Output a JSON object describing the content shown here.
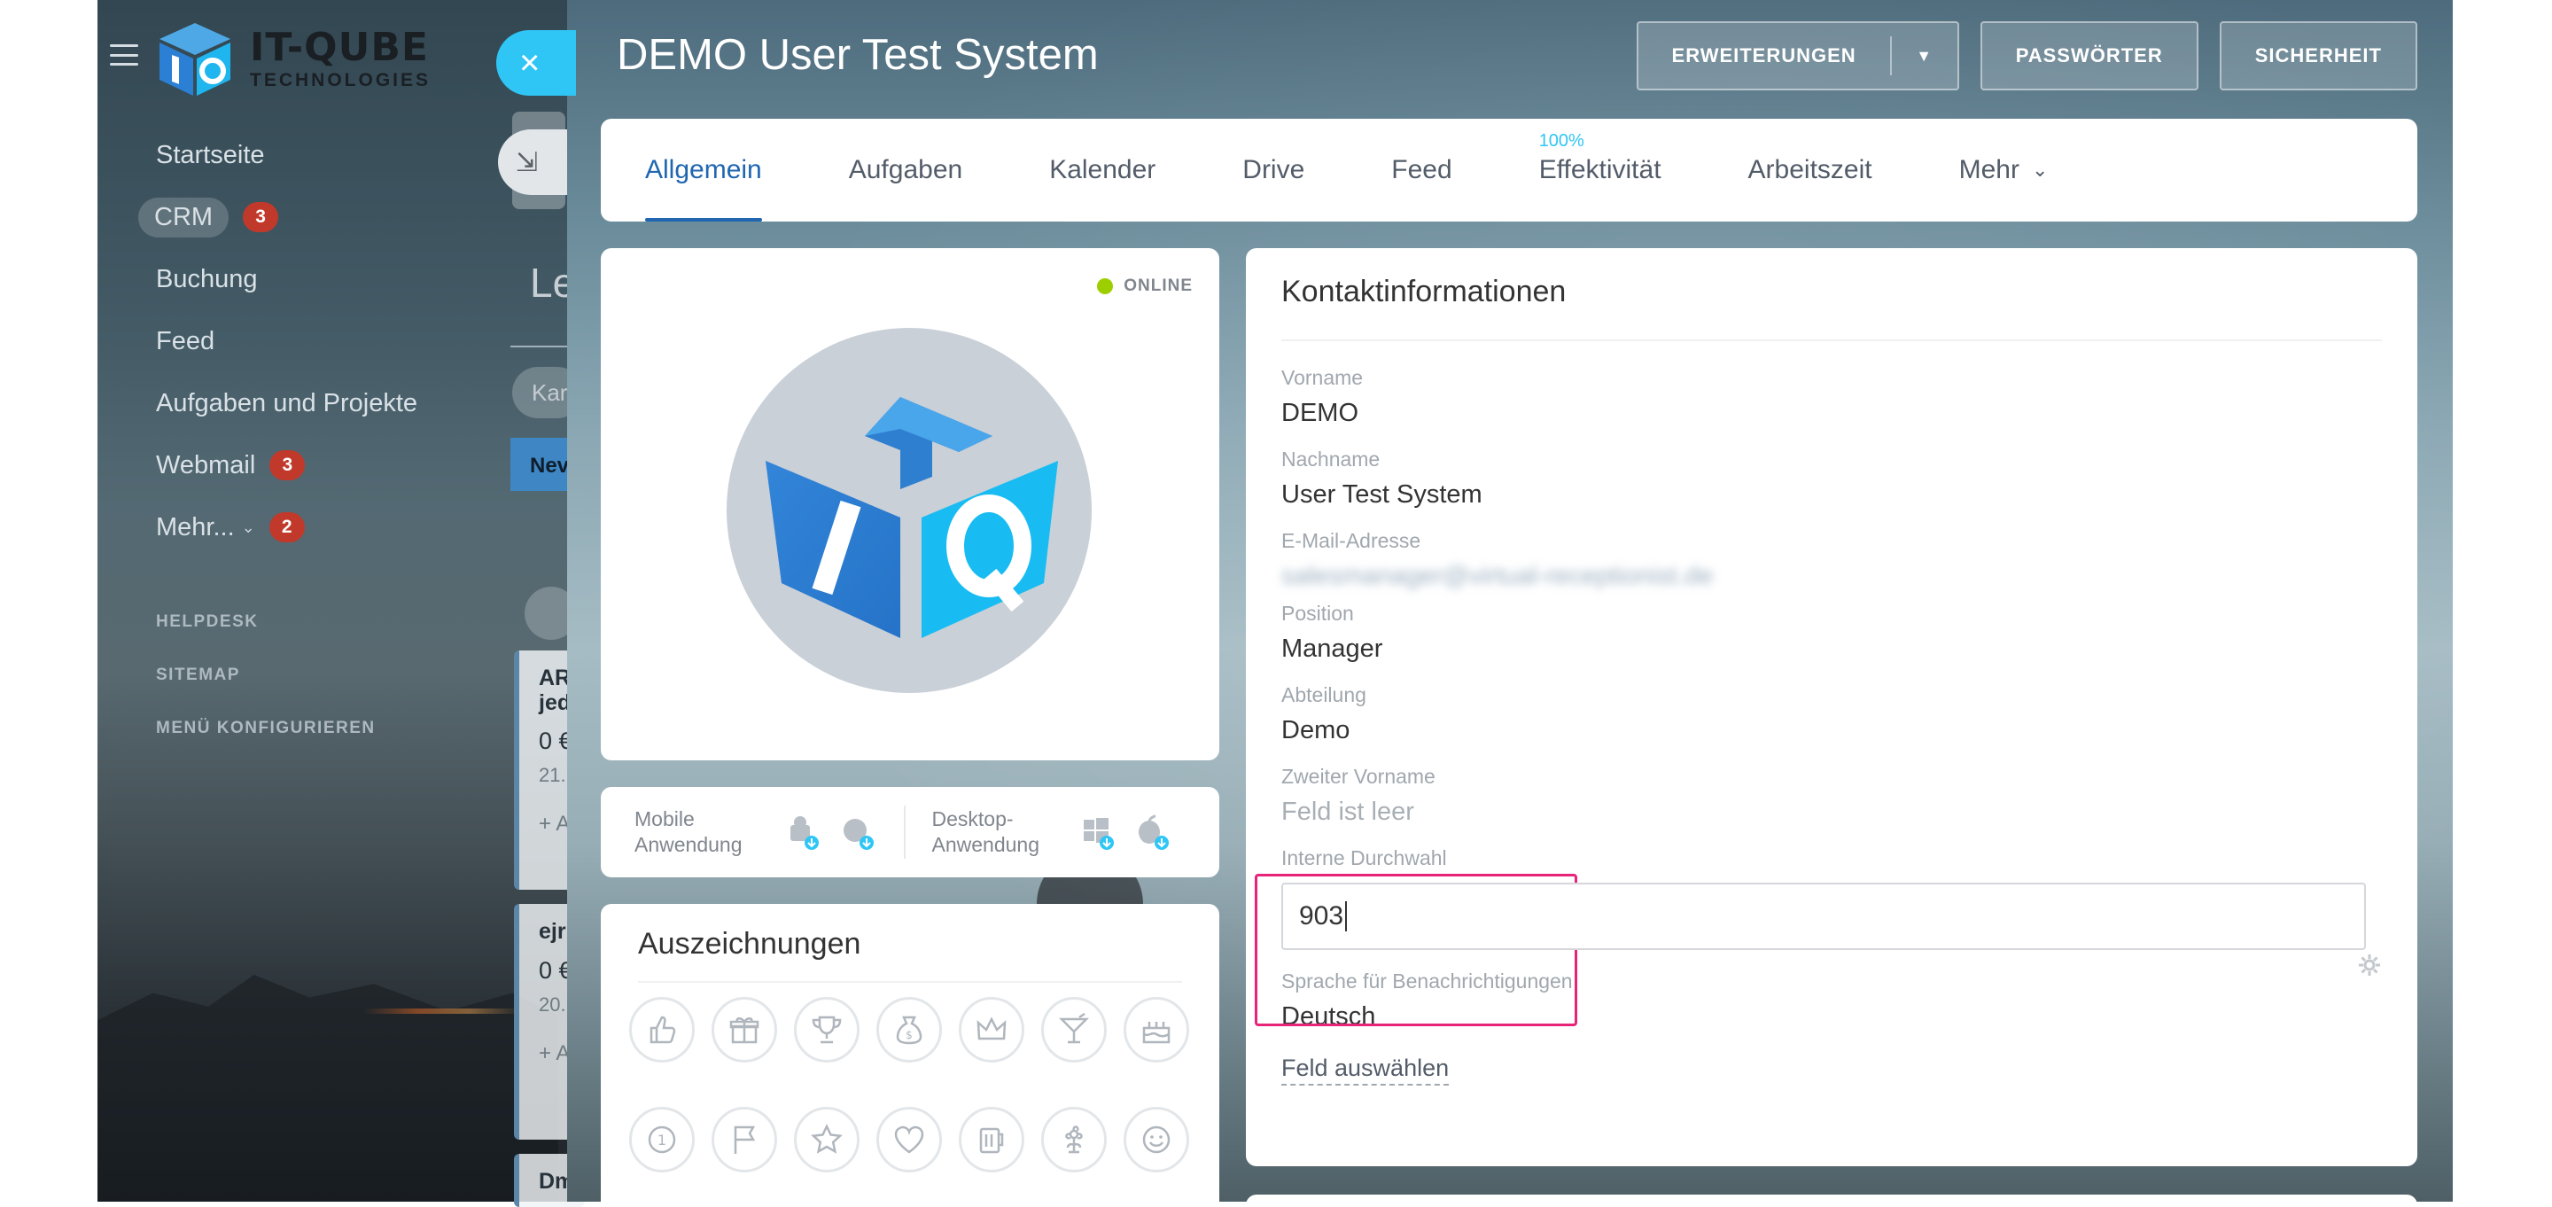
{
  "brand": {
    "name": "IT-QUBE",
    "subtitle": "TECHNOLOGIES"
  },
  "sidebar": {
    "items": [
      {
        "label": "Startseite",
        "badge": ""
      },
      {
        "label": "CRM",
        "badge": "3"
      },
      {
        "label": "Buchung",
        "badge": ""
      },
      {
        "label": "Feed",
        "badge": ""
      },
      {
        "label": "Aufgaben und Projekte",
        "badge": ""
      },
      {
        "label": "Webmail",
        "badge": "3"
      },
      {
        "label": "Mehr...",
        "badge": "2"
      }
    ],
    "links": [
      "HELPDESK",
      "SITEMAP",
      "MENÜ KONFIGURIEREN"
    ]
  },
  "behind": {
    "title": "Le",
    "search_placeholder": "Kar",
    "stage": "Nev",
    "cards": [
      {
        "title": "AR\njed",
        "value": "0 €",
        "date": "21.",
        "add": "+ A"
      },
      {
        "title": "ejr",
        "value": "0 €",
        "date": "20.",
        "add": "+ A"
      },
      {
        "title": "Dm",
        "value": "",
        "date": "",
        "add": ""
      }
    ]
  },
  "slider": {
    "title": "DEMO User Test System",
    "actions": {
      "extensions": "ERWEITERUNGEN",
      "passwords": "PASSWÖRTER",
      "security": "SICHERHEIT"
    },
    "tabs": [
      {
        "label": "Allgemein",
        "sup": ""
      },
      {
        "label": "Aufgaben",
        "sup": ""
      },
      {
        "label": "Kalender",
        "sup": ""
      },
      {
        "label": "Drive",
        "sup": ""
      },
      {
        "label": "Feed",
        "sup": ""
      },
      {
        "label": "Effektivität",
        "sup": "100%"
      },
      {
        "label": "Arbeitszeit",
        "sup": ""
      },
      {
        "label": "Mehr",
        "sup": ""
      }
    ],
    "status": "ONLINE",
    "apps": {
      "mobile": "Mobile\nAnwendung",
      "desktop": "Desktop-\nAnwendung"
    },
    "awards_title": "Auszeichnungen",
    "awards": [
      "thumbs-up-icon",
      "gift-icon",
      "trophy-icon",
      "money-bag-icon",
      "crown-icon",
      "cocktail-icon",
      "cake-icon",
      "number-one-icon",
      "flag-icon",
      "star-icon",
      "heart-icon",
      "beer-icon",
      "flower-icon",
      "smile-icon"
    ],
    "contact": {
      "title": "Kontaktinformationen",
      "fields": [
        {
          "label": "Vorname",
          "value": "DEMO"
        },
        {
          "label": "Nachname",
          "value": "User Test System"
        },
        {
          "label": "E-Mail-Adresse",
          "value": "salesmanager@virtual-receptionist.de"
        },
        {
          "label": "Position",
          "value": "Manager"
        },
        {
          "label": "Abteilung",
          "value": "Demo"
        },
        {
          "label": "Zweiter Vorname",
          "value": "Feld ist leer"
        }
      ],
      "extension": {
        "label": "Interne Durchwahl",
        "value": "903"
      },
      "language": {
        "label": "Sprache für Benachrichtigungen",
        "value": "Deutsch"
      },
      "pick_field": "Feld auswählen"
    }
  },
  "colors": {
    "accent": "#2066b0",
    "close": "#2fc6f6",
    "highlight": "#e8237a",
    "online": "#9dcf00",
    "badge": "#c1392b"
  }
}
